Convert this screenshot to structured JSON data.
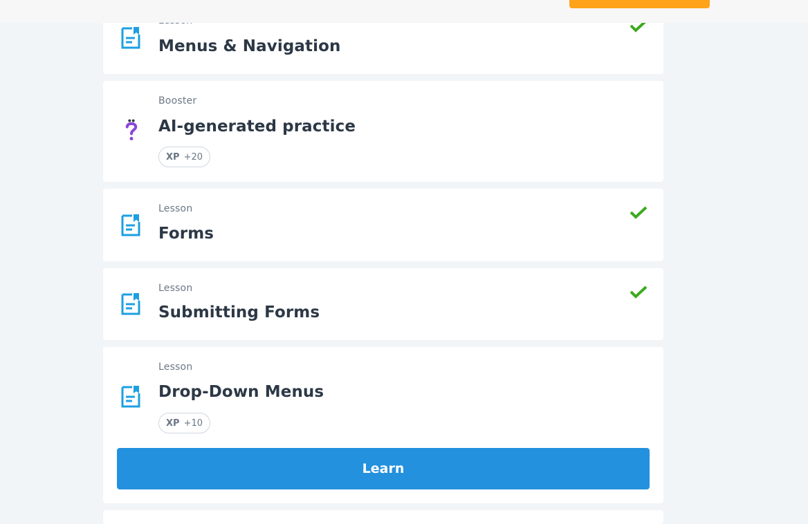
{
  "colors": {
    "background": "#f1f5f8",
    "card": "#ffffff",
    "lesson_icon": "#1d9fe3",
    "booster_icon": "#8b45d6",
    "check": "#3daa1d",
    "learn_button": "#2391dd",
    "top_button": "#ffa31a"
  },
  "items": [
    {
      "kind": "Lesson",
      "title": "Menus & Navigation",
      "icon": "lesson-document-icon",
      "completed": true
    },
    {
      "kind": "Booster",
      "title": "AI-generated practice",
      "icon": "question-mark-icon",
      "xp_label": "XP",
      "xp_value": "+20"
    },
    {
      "kind": "Lesson",
      "title": "Forms",
      "icon": "lesson-document-icon",
      "completed": true
    },
    {
      "kind": "Lesson",
      "title": "Submitting Forms",
      "icon": "lesson-document-icon",
      "completed": true
    },
    {
      "kind": "Lesson",
      "title": "Drop-Down Menus",
      "icon": "lesson-document-icon",
      "xp_label": "XP",
      "xp_value": "+10",
      "button_label": "Learn"
    }
  ]
}
